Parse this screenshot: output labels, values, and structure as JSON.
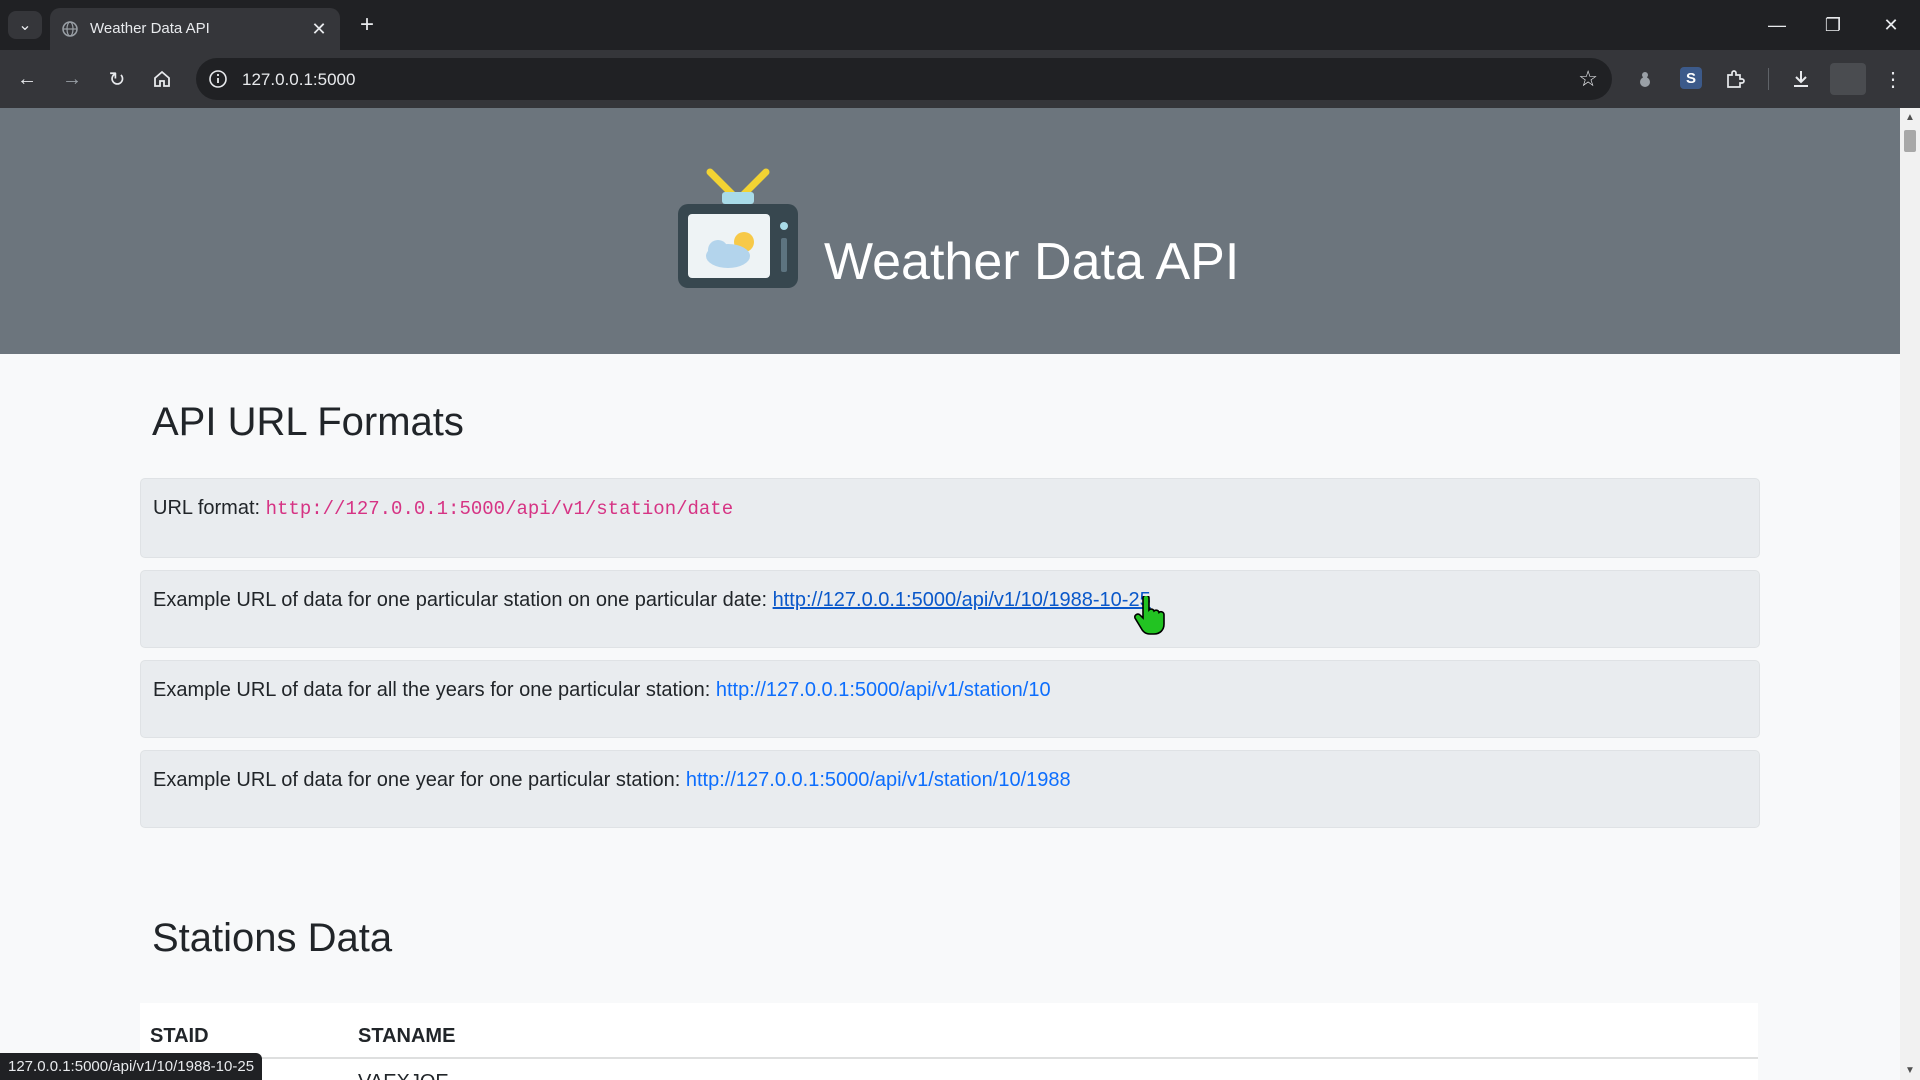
{
  "browser": {
    "tab_title": "Weather Data API",
    "address": "127.0.0.1:5000",
    "status_url": "127.0.0.1:5000/api/v1/10/1988-10-25",
    "ext_badge": "S"
  },
  "header": {
    "title": "Weather Data API"
  },
  "api_section": {
    "heading": "API URL Formats",
    "format_label": "URL format: ",
    "format_code": "http://127.0.0.1:5000/api/v1/station/date",
    "examples": [
      {
        "label": "Example URL of data for one particular station on one particular date: ",
        "link": "http://127.0.0.1:5000/api/v1/10/1988-10-25"
      },
      {
        "label": "Example URL of data for all the years for one particular station: ",
        "link": "http://127.0.0.1:5000/api/v1/station/10"
      },
      {
        "label": "Example URL of data for one year for one particular station: ",
        "link": "http://127.0.0.1:5000/api/v1/station/10/1988"
      }
    ]
  },
  "stations_section": {
    "heading": "Stations Data",
    "columns": [
      "STAID",
      "STANAME"
    ],
    "first_row_partial": "VAEXJOE"
  },
  "colors": {
    "hero_bg": "#6c757d",
    "link": "#0d6efd",
    "code": "#d63384"
  }
}
